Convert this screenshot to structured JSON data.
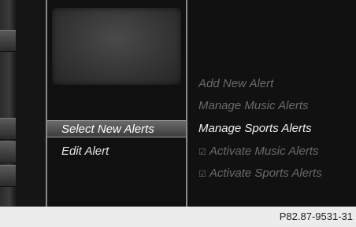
{
  "menu": {
    "items": [
      {
        "label": "Select New Alerts"
      },
      {
        "label": "Edit Alert"
      }
    ]
  },
  "submenu": {
    "items": [
      {
        "label": "Add New Alert",
        "state": "disabled"
      },
      {
        "label": "Manage Music Alerts",
        "state": "disabled"
      },
      {
        "label": "Manage Sports Alerts",
        "state": "active"
      },
      {
        "label": "Activate Music Alerts",
        "state": "disabled",
        "checked": true
      },
      {
        "label": "Activate Sports Alerts",
        "state": "disabled",
        "checked": true
      }
    ]
  },
  "footer": {
    "figure_id": "P82.87-9531-31"
  },
  "colors": {
    "text_active": "#f0f0f0",
    "text_disabled": "#6a6a6a",
    "screen_bg": "#111111"
  }
}
